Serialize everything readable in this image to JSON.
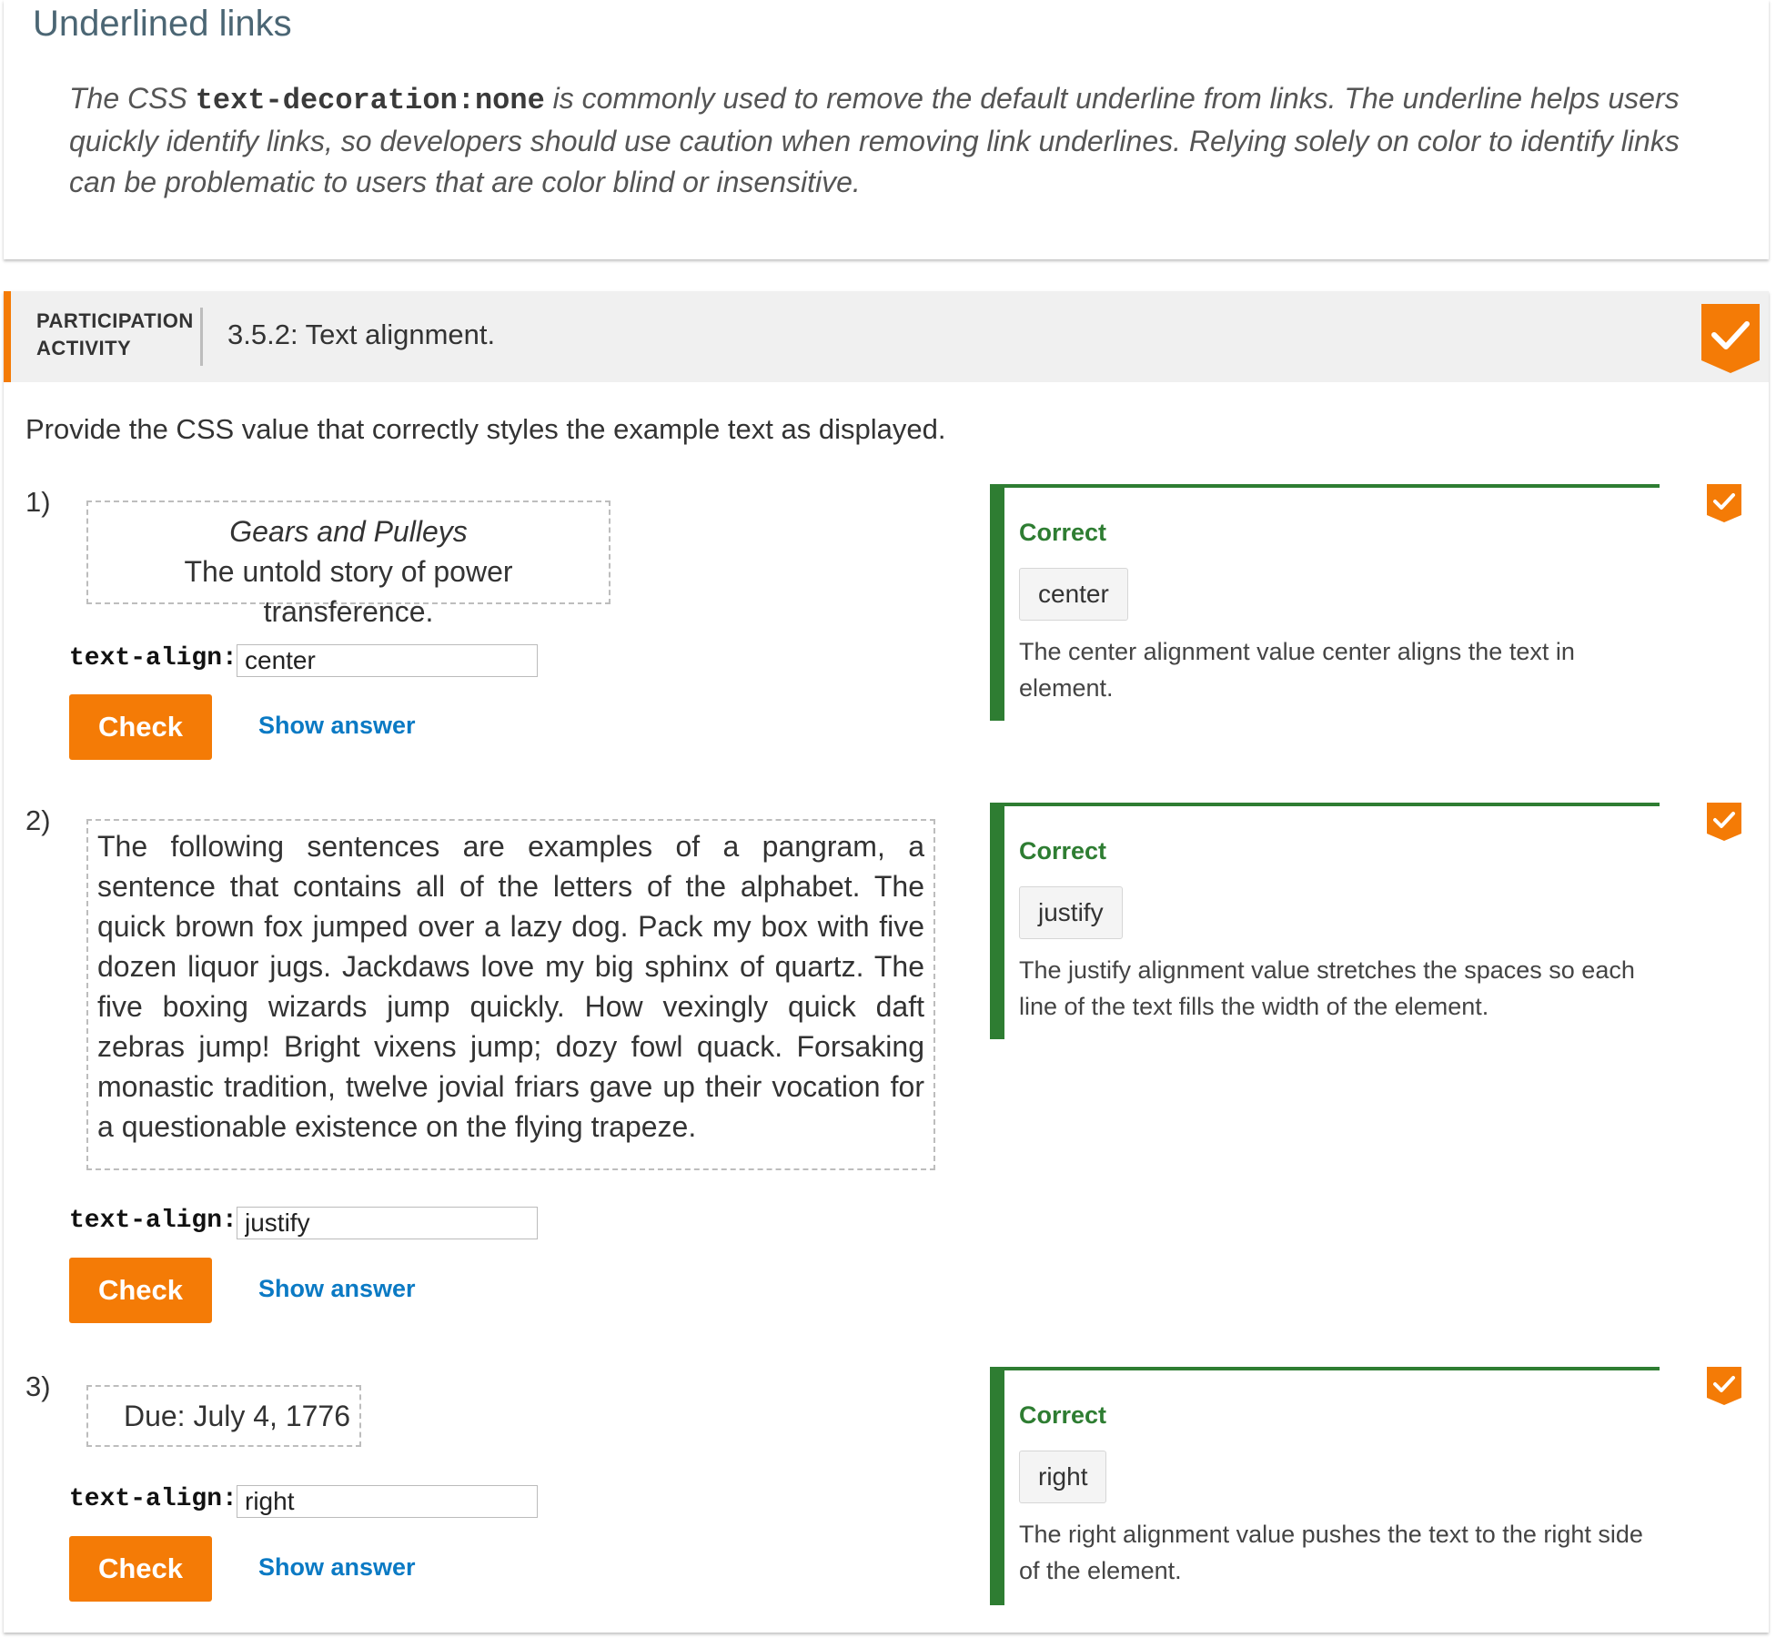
{
  "top": {
    "title": "Underlined links",
    "text_before": "The CSS ",
    "code": "text-decoration:none",
    "text_after": " is commonly used to remove the default underline from links. The underline helps users quickly identify links, so developers should use caution when removing link underlines. Relying solely on color to identify links can be problematic to users that are color blind or insensitive."
  },
  "activity": {
    "label_line1": "PARTICIPATION",
    "label_line2": "ACTIVITY",
    "title": "3.5.2: Text alignment.",
    "badge_icon": "checkmark-badge-icon",
    "accent_color": "#f47b06",
    "instructions": "Provide the CSS value that correctly styles the example text as displayed."
  },
  "questions": [
    {
      "number": "1)",
      "example_line1": "Gears and Pulleys",
      "example_line2": "The untold story of power transference.",
      "property": "text-align:",
      "input_value": "center",
      "check_label": "Check",
      "show_answer_label": "Show answer",
      "feedback_title": "Correct",
      "feedback_answer": "center",
      "feedback_explanation": "The center alignment value center aligns the text in element."
    },
    {
      "number": "2)",
      "example_text": "The following sentences are examples of a pangram, a sentence that contains all of the letters of the alphabet. The quick brown fox jumped over a lazy dog. Pack my box with five dozen liquor jugs. Jackdaws love my big sphinx of quartz. The five boxing wizards jump quickly. How vexingly quick daft zebras jump! Bright vixens jump; dozy fowl quack. Forsaking monastic tradition, twelve jovial friars gave up their vocation for a questionable existence on the flying trapeze.",
      "property": "text-align:",
      "input_value": "justify",
      "check_label": "Check",
      "show_answer_label": "Show answer",
      "feedback_title": "Correct",
      "feedback_answer": "justify",
      "feedback_explanation": "The justify alignment value stretches the spaces so each line of the text fills the width of the element."
    },
    {
      "number": "3)",
      "example_text": "Due: July 4, 1776",
      "property": "text-align:",
      "input_value": "right",
      "check_label": "Check",
      "show_answer_label": "Show answer",
      "feedback_title": "Correct",
      "feedback_answer": "right",
      "feedback_explanation": "The right alignment value pushes the text to the right side of the element."
    }
  ],
  "colors": {
    "orange": "#f47b06",
    "correct_green": "#2e7d32",
    "link_blue": "#0b7ac4"
  }
}
